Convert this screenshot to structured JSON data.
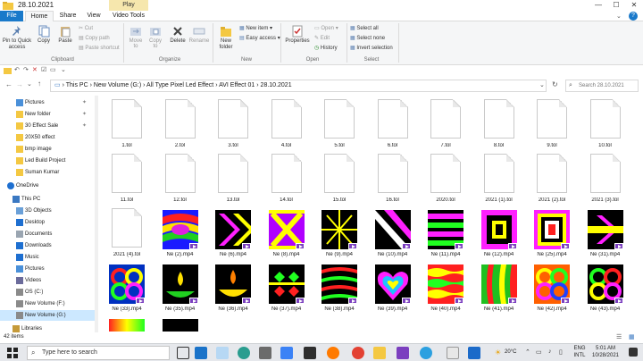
{
  "window": {
    "title": "28.10.2021",
    "context_tab": "Play",
    "controls": {
      "minimize": "—",
      "maximize": "☐",
      "close": "✕"
    }
  },
  "tabs": [
    "File",
    "Home",
    "Share",
    "View",
    "Video Tools"
  ],
  "ribbon": {
    "clipboard": {
      "pin": "Pin to Quick access",
      "copy": "Copy",
      "paste": "Paste",
      "cut": "Cut",
      "copy_path": "Copy path",
      "paste_shortcut": "Paste shortcut",
      "label": "Clipboard"
    },
    "organize": {
      "move_to": "Move to",
      "copy_to": "Copy to",
      "delete": "Delete",
      "rename": "Rename",
      "label": "Organize"
    },
    "new": {
      "new_folder": "New folder",
      "new_item": "New item ▾",
      "easy_access": "Easy access ▾",
      "label": "New"
    },
    "open": {
      "properties": "Properties",
      "open": "Open ▾",
      "edit": "Edit",
      "history": "History",
      "label": "Open"
    },
    "select": {
      "select_all": "Select all",
      "select_none": "Select none",
      "invert": "Invert selection",
      "label": "Select"
    }
  },
  "address": {
    "path": [
      "This PC",
      "New Volume (G:)",
      "All Type Pixel Led Effect",
      "AVI Effect 01",
      "28.10.2021"
    ],
    "search_placeholder": "Search 28.10.2021"
  },
  "sidebar": {
    "items": [
      {
        "label": "Pictures",
        "icon": "pictures-folder-icon",
        "pinned": true
      },
      {
        "label": "New folder",
        "icon": "folder-icon",
        "pinned": true
      },
      {
        "label": "30 Effect  Sale",
        "icon": "folder-icon",
        "pinned": true
      },
      {
        "label": "20X50 effect",
        "icon": "folder-icon",
        "pinned": false
      },
      {
        "label": "bmp image",
        "icon": "folder-icon",
        "pinned": false
      },
      {
        "label": "Led Build Project",
        "icon": "folder-icon",
        "pinned": false
      },
      {
        "label": "Suman Kumar",
        "icon": "folder-icon",
        "pinned": false
      },
      {
        "label": "OneDrive",
        "icon": "onedrive-icon",
        "pinned": false
      },
      {
        "label": "This PC",
        "icon": "computer-icon",
        "pinned": false
      },
      {
        "label": "3D Objects",
        "icon": "3d-objects-icon",
        "pinned": false
      },
      {
        "label": "Desktop",
        "icon": "desktop-icon",
        "pinned": false
      },
      {
        "label": "Documents",
        "icon": "documents-icon",
        "pinned": false
      },
      {
        "label": "Downloads",
        "icon": "downloads-icon",
        "pinned": false
      },
      {
        "label": "Music",
        "icon": "music-icon",
        "pinned": false
      },
      {
        "label": "Pictures",
        "icon": "pictures-folder-icon",
        "pinned": false
      },
      {
        "label": "Videos",
        "icon": "videos-icon",
        "pinned": false
      },
      {
        "label": "OS (C:)",
        "icon": "drive-icon",
        "pinned": false
      },
      {
        "label": "New Volume (F:)",
        "icon": "drive-icon",
        "pinned": false
      },
      {
        "label": "New Volume (G:)",
        "icon": "drive-icon",
        "pinned": false
      },
      {
        "label": "Libraries",
        "icon": "libraries-icon",
        "pinned": false
      }
    ]
  },
  "files": [
    {
      "name": "1.tol",
      "kind": "doc"
    },
    {
      "name": "2.tol",
      "kind": "doc"
    },
    {
      "name": "3.tol",
      "kind": "doc"
    },
    {
      "name": "4.tol",
      "kind": "doc"
    },
    {
      "name": "5.tol",
      "kind": "doc"
    },
    {
      "name": "6.tol",
      "kind": "doc"
    },
    {
      "name": "7.tol",
      "kind": "doc"
    },
    {
      "name": "8.tol",
      "kind": "doc"
    },
    {
      "name": "9.tol",
      "kind": "doc"
    },
    {
      "name": "10.tol",
      "kind": "doc"
    },
    {
      "name": "11.tol",
      "kind": "doc"
    },
    {
      "name": "12.tol",
      "kind": "doc"
    },
    {
      "name": "13.tol",
      "kind": "doc"
    },
    {
      "name": "14.tol",
      "kind": "doc"
    },
    {
      "name": "15.tol",
      "kind": "doc"
    },
    {
      "name": "16.tol",
      "kind": "doc"
    },
    {
      "name": "2020.tol",
      "kind": "doc"
    },
    {
      "name": "2021 (1).tol",
      "kind": "doc"
    },
    {
      "name": "2021 (2).tol",
      "kind": "doc"
    },
    {
      "name": "2021 (3).tol",
      "kind": "doc"
    },
    {
      "name": "2021 (4).tol",
      "kind": "doc"
    },
    {
      "name": "Ne  (2).mp4",
      "kind": "vid",
      "art": "wave"
    },
    {
      "name": "Ne  (6).mp4",
      "kind": "vid",
      "art": "chevrons"
    },
    {
      "name": "Ne  (8).mp4",
      "kind": "vid",
      "art": "x"
    },
    {
      "name": "Ne  (9).mp4",
      "kind": "vid",
      "art": "burst"
    },
    {
      "name": "Ne  (10).mp4",
      "kind": "vid",
      "art": "diag"
    },
    {
      "name": "Ne  (11).mp4",
      "kind": "vid",
      "art": "bands"
    },
    {
      "name": "Ne  (12).mp4",
      "kind": "vid",
      "art": "squares"
    },
    {
      "name": "Ne  (25).mp4",
      "kind": "vid",
      "art": "squares2"
    },
    {
      "name": "Ne  (31).mp4",
      "kind": "vid",
      "art": "arrow"
    },
    {
      "name": "Ne  (33).mp4",
      "kind": "vid",
      "art": "rings"
    },
    {
      "name": "Ne  (35).mp4",
      "kind": "vid",
      "art": "lamp"
    },
    {
      "name": "Ne  (36).mp4",
      "kind": "vid",
      "art": "lamp2"
    },
    {
      "name": "Ne  (37).mp4",
      "kind": "vid",
      "art": "diamonds"
    },
    {
      "name": "Ne  (38).mp4",
      "kind": "vid",
      "art": "stripes"
    },
    {
      "name": "Ne  (39).mp4",
      "kind": "vid",
      "art": "heart"
    },
    {
      "name": "Ne  (40).mp4",
      "kind": "vid",
      "art": "waves2"
    },
    {
      "name": "Ne  (41).mp4",
      "kind": "vid",
      "art": "waves3"
    },
    {
      "name": "Ne  (42).mp4",
      "kind": "vid",
      "art": "rings2"
    },
    {
      "name": "Ne  (43).mp4",
      "kind": "vid",
      "art": "rings3"
    }
  ],
  "status": {
    "items_count": "42 items"
  },
  "taskbar": {
    "search_placeholder": "Type here to search",
    "weather": "20°C",
    "lang": "ENG",
    "lang2": "INTL",
    "time": "5:01 AM",
    "date": "10/28/2021"
  },
  "colors": {
    "accent": "#1979ca",
    "selection": "#cce8ff",
    "badge": "#7b3fbf",
    "folder": "#f4c842"
  }
}
